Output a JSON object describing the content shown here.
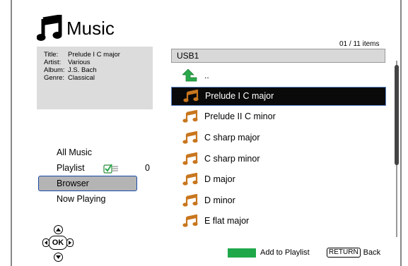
{
  "header": {
    "title": "Music",
    "item_count": "01 / 11 items"
  },
  "info": {
    "rows": [
      {
        "key": "Title:",
        "value": "Prelude I C major"
      },
      {
        "key": "Artist:",
        "value": "Various"
      },
      {
        "key": "Album:",
        "value": "J.S. Bach"
      },
      {
        "key": "Genre:",
        "value": "Classical"
      }
    ]
  },
  "menu": {
    "all_music": "All Music",
    "playlist": "Playlist",
    "playlist_count": "0",
    "browser": "Browser",
    "now_playing": "Now Playing"
  },
  "nav": {
    "ok": "OK"
  },
  "browser": {
    "path": "USB1",
    "up_label": "..",
    "files": [
      "Prelude I C major",
      "Prelude II C minor",
      "C sharp major",
      "C sharp minor",
      "D major",
      "D minor",
      "E flat major"
    ]
  },
  "footer": {
    "add_to_playlist": "Add to Playlist",
    "return_key": "RETURN",
    "back": "Back"
  },
  "colors": {
    "selection_border": "#5a86c8",
    "green_key": "#1fa84a",
    "note_icon": "#c8761e"
  },
  "icons": {
    "header": "music-note-icon",
    "up": "green-up-arrow-icon",
    "file": "orange-music-note-icon"
  }
}
